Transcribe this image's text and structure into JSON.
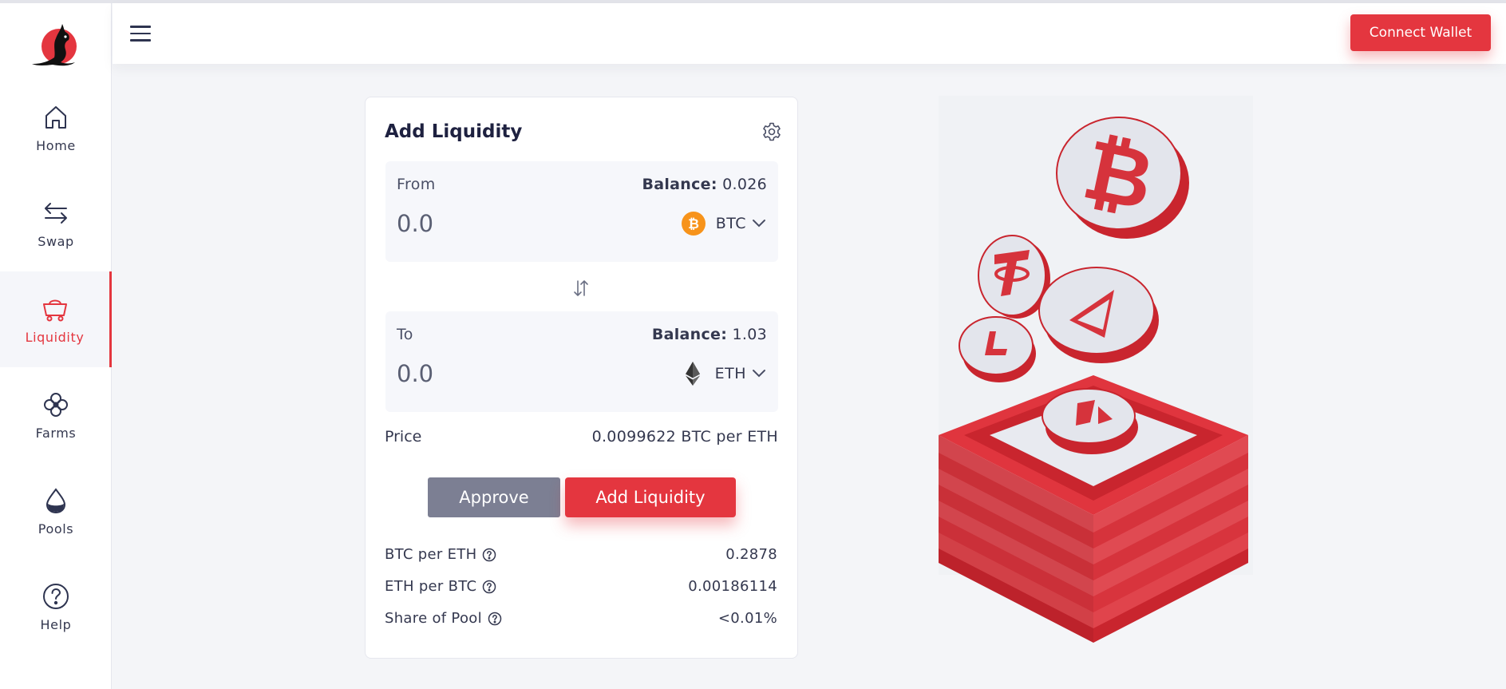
{
  "header": {
    "connect_wallet_label": "Connect Wallet"
  },
  "sidebar": {
    "items": [
      {
        "label": "Home",
        "icon": "home-icon",
        "active": false
      },
      {
        "label": "Swap",
        "icon": "swap-icon",
        "active": false
      },
      {
        "label": "Liquidity",
        "icon": "cart-icon",
        "active": true
      },
      {
        "label": "Farms",
        "icon": "farms-icon",
        "active": false
      },
      {
        "label": "Pools",
        "icon": "drop-icon",
        "active": false
      },
      {
        "label": "Help",
        "icon": "help-icon",
        "active": false
      }
    ]
  },
  "card": {
    "title": "Add Liquidity",
    "from": {
      "label": "From",
      "balance_label": "Balance:",
      "balance_value": "0.026",
      "amount_placeholder": "0.0",
      "token": "BTC",
      "token_icon": "btc-icon"
    },
    "to": {
      "label": "To",
      "balance_label": "Balance:",
      "balance_value": "1.03",
      "amount_placeholder": "0.0",
      "token": "ETH",
      "token_icon": "eth-icon"
    },
    "price_label": "Price",
    "price_value": "0.0099622 BTC per ETH",
    "approve_label": "Approve",
    "add_liquidity_label": "Add Liquidity",
    "stats": [
      {
        "label": "BTC per ETH",
        "value": "0.2878"
      },
      {
        "label": "ETH per BTC",
        "value": "0.00186114"
      },
      {
        "label": "Share of Pool",
        "value": "<0.01%"
      }
    ]
  },
  "colors": {
    "accent": "#e4363f",
    "approve_gray": "#7c7f93",
    "btc_orange": "#f7931a",
    "text_dark": "#2e3450"
  }
}
